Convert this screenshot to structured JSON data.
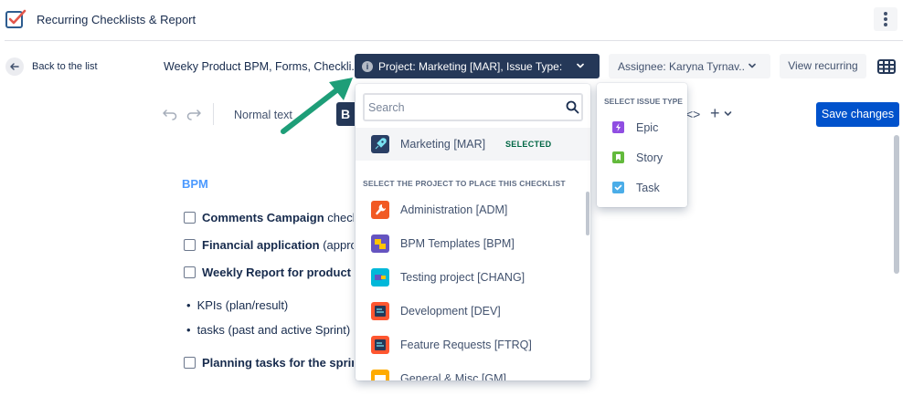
{
  "app": {
    "title": "Recurring Checklists & Report"
  },
  "nav": {
    "back_label": "Back to the list"
  },
  "checklist": {
    "name": "Weeky Product BPM, Forms, Checkli..."
  },
  "filters": {
    "project_label": "Project: Marketing [MAR], Issue Type: S...",
    "assignee_label": "Assignee: Karyna Tyrnav...",
    "view_recurring_label": "View recurring"
  },
  "editor": {
    "text_style": "Normal text",
    "bold_label": "B",
    "save_label": "Save changes",
    "heading": "BPM",
    "items": [
      {
        "bold": "Comments Campaign",
        "rest": " check"
      },
      {
        "bold": "Financial application",
        "rest": " (appro"
      },
      {
        "bold": "Weekly Report for product",
        "rest": ""
      },
      {
        "bold": "Planning tasks for the sprin",
        "rest": ""
      }
    ],
    "bullets": [
      "KPIs (plan/result)",
      "tasks (past and active Sprint)"
    ]
  },
  "project_dropdown": {
    "search_placeholder": "Search",
    "selected": {
      "name": "Marketing [MAR]",
      "badge": "SELECTED",
      "icon": "rocket-icon"
    },
    "section_label": "SELECT THE PROJECT TO PLACE THIS CHECKLIST",
    "projects": [
      {
        "name": "Administration [ADM]",
        "icon": "wrench-icon",
        "color": "#f15a24"
      },
      {
        "name": "BPM Templates [BPM]",
        "icon": "puzzle-icon",
        "color": "#6554c0"
      },
      {
        "name": "Testing project [CHANG]",
        "icon": "flag-icon",
        "color": "#00b8d9"
      },
      {
        "name": "Development [DEV]",
        "icon": "code-doc-icon",
        "color": "#ff5630"
      },
      {
        "name": "Feature Requests [FTRQ]",
        "icon": "code-doc-icon",
        "color": "#ff5630"
      },
      {
        "name": "General & Misc [GM]",
        "icon": "folder-icon",
        "color": "#ffab00"
      }
    ]
  },
  "issue_types": {
    "heading": "SELECT ISSUE TYPE",
    "items": [
      {
        "label": "Epic",
        "color": "#6554c0",
        "icon": "lightning-icon"
      },
      {
        "label": "Story",
        "color": "#36b37e",
        "icon": "bookmark-icon"
      },
      {
        "label": "Task",
        "color": "#4bade8",
        "icon": "check-icon"
      }
    ]
  }
}
